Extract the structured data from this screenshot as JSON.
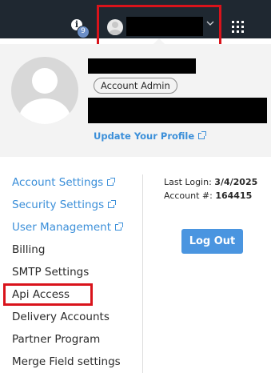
{
  "header": {
    "notification_count": "9",
    "icons": {
      "info": "info-icon",
      "apps": "apps-grid-icon",
      "dropdown": "chevron-down-icon"
    }
  },
  "profile": {
    "role_badge": "Account Admin",
    "update_link": "Update Your Profile"
  },
  "menu": {
    "items": [
      {
        "label": "Account Settings",
        "external": true
      },
      {
        "label": "Security Settings",
        "external": true
      },
      {
        "label": "User Management",
        "external": true
      },
      {
        "label": "Billing",
        "external": false
      },
      {
        "label": "SMTP Settings",
        "external": false
      },
      {
        "label": "Api Access",
        "external": false
      },
      {
        "label": "Delivery Accounts",
        "external": false
      },
      {
        "label": "Partner Program",
        "external": false
      },
      {
        "label": "Merge Field settings",
        "external": false
      }
    ]
  },
  "account": {
    "last_login_label": "Last Login:",
    "last_login_value": "3/4/2025",
    "account_number_label": "Account #:",
    "account_number_value": "164415"
  },
  "actions": {
    "logout_label": "Log Out"
  },
  "colors": {
    "topbar": "#1f2831",
    "link": "#3b8fd9",
    "button": "#4a95e0",
    "highlight": "#d9131b"
  }
}
